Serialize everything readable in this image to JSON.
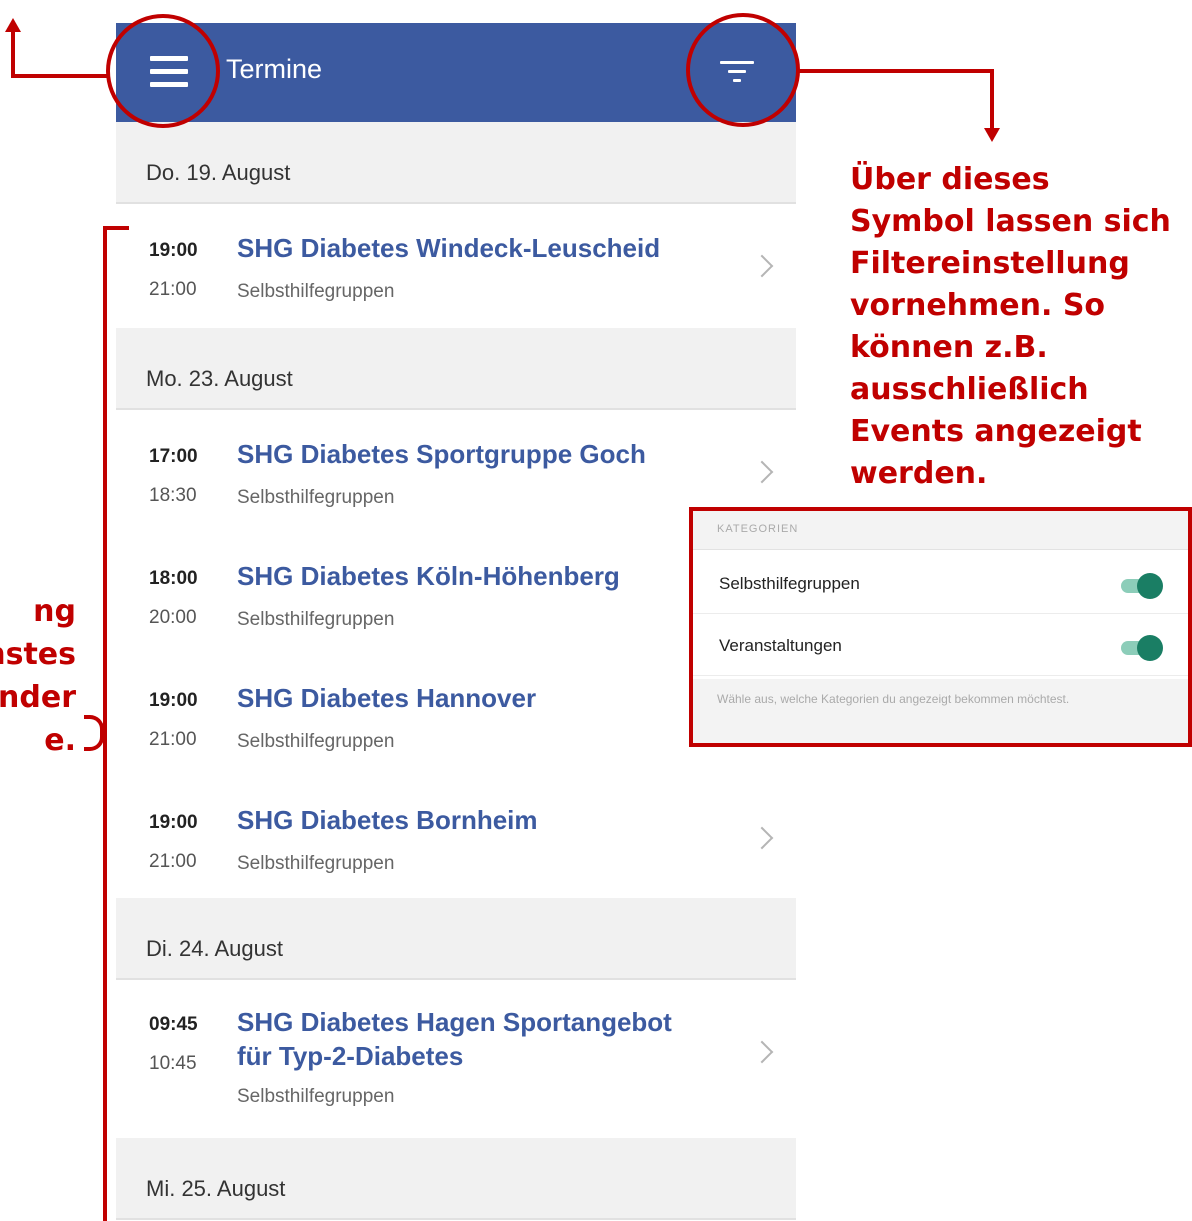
{
  "app": {
    "title": "Termine"
  },
  "days": [
    {
      "date": "Do. 19. August",
      "events": [
        {
          "start": "19:00",
          "end": "21:00",
          "title": "SHG Diabetes Windeck-Leuscheid",
          "category": "Selbsthilfegruppen"
        }
      ]
    },
    {
      "date": "Mo. 23. August",
      "events": [
        {
          "start": "17:00",
          "end": "18:30",
          "title": "SHG Diabetes Sportgruppe Goch",
          "category": "Selbsthilfegruppen"
        },
        {
          "start": "18:00",
          "end": "20:00",
          "title": "SHG Diabetes Köln-Höhenberg",
          "category": "Selbsthilfegruppen"
        },
        {
          "start": "19:00",
          "end": "21:00",
          "title": "SHG Diabetes Hannover",
          "category": "Selbsthilfegruppen"
        },
        {
          "start": "19:00",
          "end": "21:00",
          "title": "SHG Diabetes Bornheim",
          "category": "Selbsthilfegruppen"
        }
      ]
    },
    {
      "date": "Di. 24. August",
      "events": [
        {
          "start": "09:45",
          "end": "10:45",
          "title": "SHG Diabetes Hagen Sportangebot für Typ-2-Diabetes",
          "category": "Selbsthilfegruppen"
        }
      ]
    },
    {
      "date": "Mi. 25. August",
      "events": []
    }
  ],
  "annotations": {
    "filter_note": [
      "Über dieses",
      "Symbol lassen sich",
      "Filtereinstellung",
      "vornehmen. So",
      "können z.B.",
      "ausschließlich",
      "Events angezeigt",
      "werden."
    ],
    "left_note": [
      "ng",
      "nstes",
      "ender",
      "e."
    ]
  },
  "filter_panel": {
    "header": "KATEGORIEN",
    "toggles": [
      {
        "label": "Selbsthilfegruppen",
        "on": true
      },
      {
        "label": "Veranstaltungen",
        "on": true
      }
    ],
    "note": "Wähle aus, welche Kategorien du angezeigt bekommen möchtest."
  },
  "colors": {
    "appbar": "#3c5aa0",
    "annotation": "#c00000",
    "toggle": "#1a7e64"
  },
  "icons": {
    "menu": "hamburger-icon",
    "filter": "filter-icon",
    "chevron": "chevron-right-icon"
  }
}
